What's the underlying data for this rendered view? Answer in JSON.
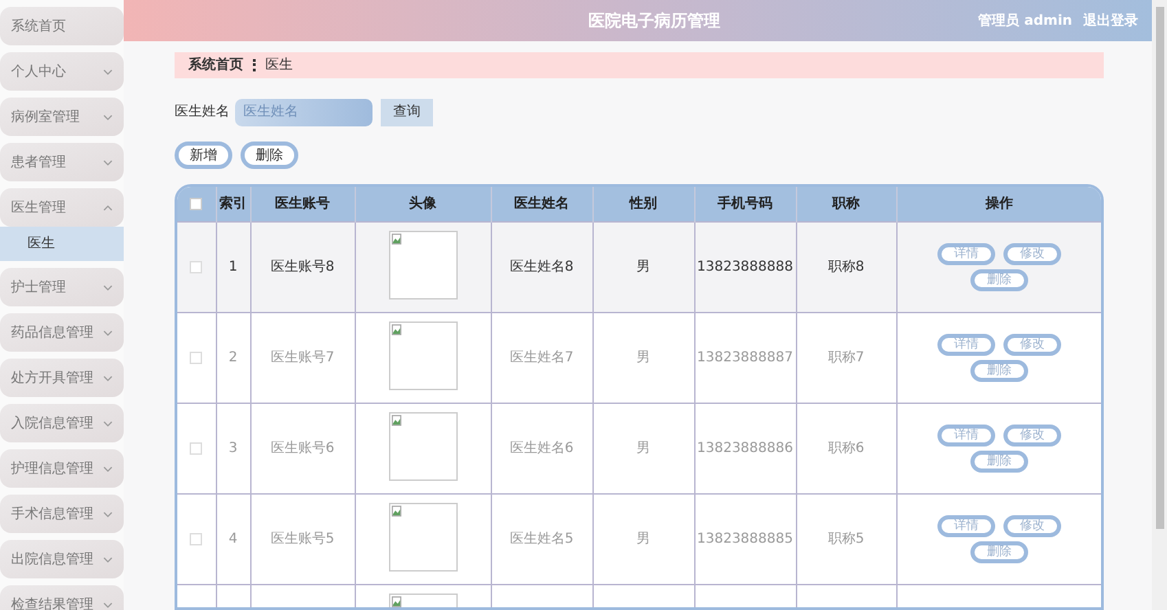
{
  "header": {
    "title": "医院电子病历管理",
    "user": "管理员 admin",
    "logout": "退出登录"
  },
  "sidebar": {
    "items": [
      {
        "label": "系统首页",
        "kind": "link",
        "selected": false
      },
      {
        "label": "个人中心",
        "kind": "group",
        "expanded": false
      },
      {
        "label": "病例室管理",
        "kind": "group",
        "expanded": false
      },
      {
        "label": "患者管理",
        "kind": "group",
        "expanded": false
      },
      {
        "label": "医生管理",
        "kind": "group",
        "expanded": true,
        "children": [
          {
            "label": "医生",
            "selected": true
          }
        ]
      },
      {
        "label": "护士管理",
        "kind": "group",
        "expanded": false
      },
      {
        "label": "药品信息管理",
        "kind": "group",
        "expanded": false
      },
      {
        "label": "处方开具管理",
        "kind": "group",
        "expanded": false
      },
      {
        "label": "入院信息管理",
        "kind": "group",
        "expanded": false
      },
      {
        "label": "护理信息管理",
        "kind": "group",
        "expanded": false
      },
      {
        "label": "手术信息管理",
        "kind": "group",
        "expanded": false
      },
      {
        "label": "出院信息管理",
        "kind": "group",
        "expanded": false
      },
      {
        "label": "检查结果管理",
        "kind": "group",
        "expanded": false
      }
    ]
  },
  "breadcrumb": [
    "系统首页",
    "医生"
  ],
  "search": {
    "label": "医生姓名",
    "placeholder": "医生姓名",
    "button": "查询"
  },
  "actions": [
    "新增",
    "删除"
  ],
  "table": {
    "select_all_checked": false,
    "columns": [
      "索引",
      "医生账号",
      "头像",
      "医生姓名",
      "性别",
      "手机号码",
      "职称",
      "操作"
    ],
    "rows": [
      {
        "kind": "full",
        "hovered": true,
        "checked": false,
        "cells": [
          "1",
          "医生账号8",
          "",
          "医生姓名8",
          "男",
          "13823888888",
          "职称8"
        ],
        "buttons": [
          "详情",
          "修改",
          "删除"
        ]
      },
      {
        "kind": "full",
        "hovered": false,
        "checked": false,
        "cells": [
          "2",
          "医生账号7",
          "",
          "医生姓名7",
          "男",
          "13823888887",
          "职称7"
        ],
        "buttons": [
          "详情",
          "修改",
          "删除"
        ]
      },
      {
        "kind": "full",
        "hovered": false,
        "checked": false,
        "cells": [
          "3",
          "医生账号6",
          "",
          "医生姓名6",
          "男",
          "13823888886",
          "职称6"
        ],
        "buttons": [
          "详情",
          "修改",
          "删除"
        ]
      },
      {
        "kind": "full",
        "hovered": false,
        "checked": false,
        "cells": [
          "4",
          "医生账号5",
          "",
          "医生姓名5",
          "男",
          "13823888885",
          "职称5"
        ],
        "buttons": [
          "详情",
          "修改",
          "删除"
        ]
      },
      {
        "kind": "cut"
      }
    ]
  }
}
